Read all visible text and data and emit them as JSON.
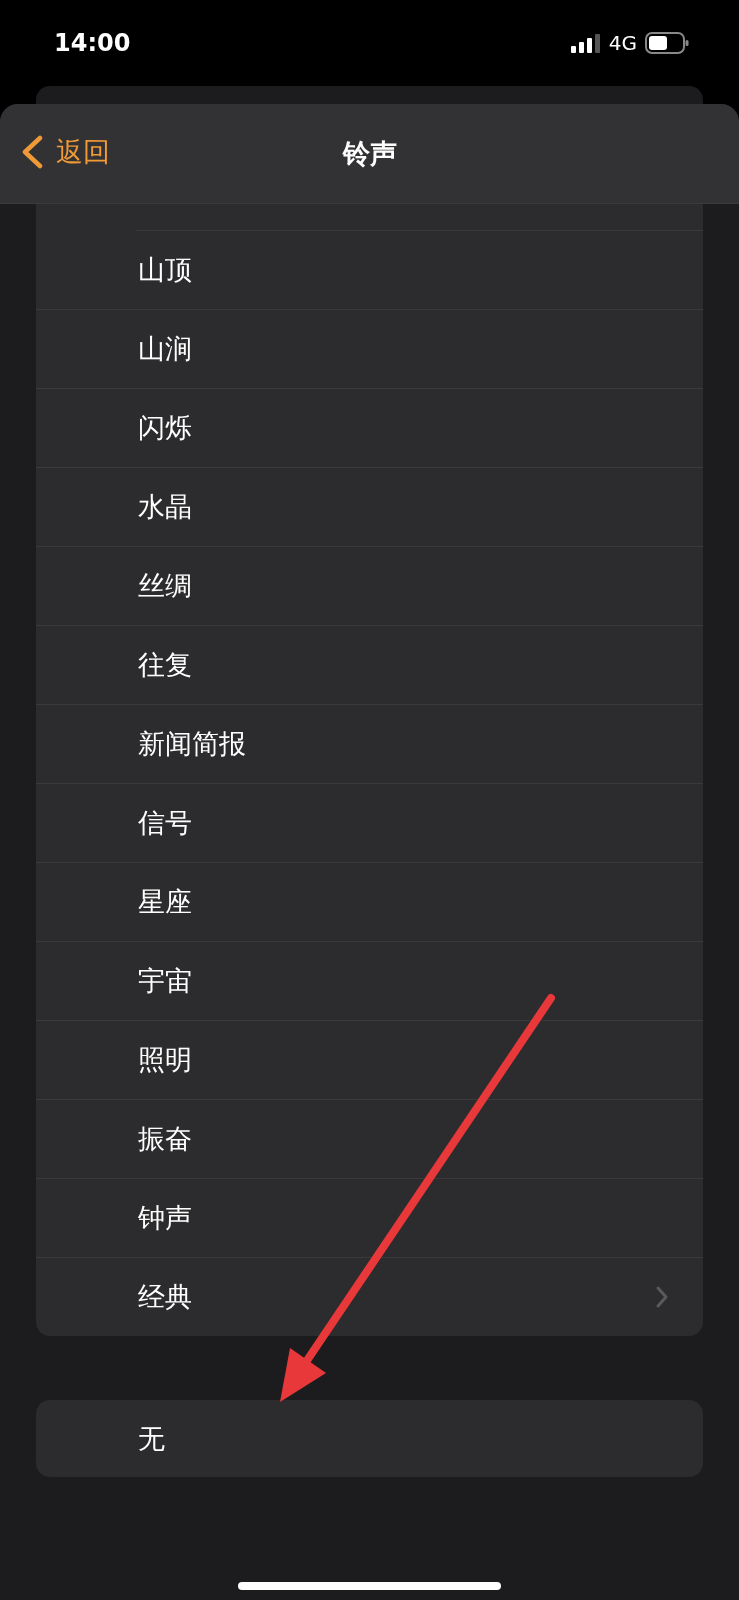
{
  "status_bar": {
    "time": "14:00",
    "network": "4G"
  },
  "nav": {
    "back": "返回",
    "title": "铃声"
  },
  "ringtones": [
    {
      "name": "山顶",
      "disclosure": false
    },
    {
      "name": "山涧",
      "disclosure": false
    },
    {
      "name": "闪烁",
      "disclosure": false
    },
    {
      "name": "水晶",
      "disclosure": false
    },
    {
      "name": "丝绸",
      "disclosure": false
    },
    {
      "name": "往复",
      "disclosure": false
    },
    {
      "name": "新闻简报",
      "disclosure": false
    },
    {
      "name": "信号",
      "disclosure": false
    },
    {
      "name": "星座",
      "disclosure": false
    },
    {
      "name": "宇宙",
      "disclosure": false
    },
    {
      "name": "照明",
      "disclosure": false
    },
    {
      "name": "振奋",
      "disclosure": false
    },
    {
      "name": "钟声",
      "disclosure": false
    },
    {
      "name": "经典",
      "disclosure": true
    }
  ],
  "none_option": {
    "name": "无"
  },
  "annotations": [
    {
      "kind": "arrow"
    }
  ]
}
